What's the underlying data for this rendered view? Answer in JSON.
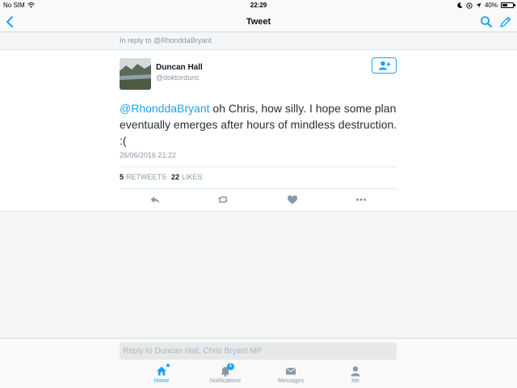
{
  "status_bar": {
    "carrier": "No SIM",
    "time": "22:29",
    "battery_percent": "40%",
    "battery_level": 0.4
  },
  "nav": {
    "title": "Tweet",
    "icons": [
      "chevron-left-icon",
      "search-icon",
      "compose-icon"
    ]
  },
  "reply_context": "In reply to @RhonddaBryant",
  "tweet": {
    "author_name": "Duncan Hall",
    "author_handle": "@doktordunc",
    "mention": "@RhonddaBryant",
    "text": " oh Chris, how silly. I hope some plan eventually emerges after hours of mindless destruction. :(",
    "timestamp": "26/06/2016 21:22",
    "retweets_count": "5",
    "retweets_label": "RETWEETS",
    "likes_count": "22",
    "likes_label": "LIKES"
  },
  "actions": [
    "reply-icon",
    "retweet-icon",
    "like-icon",
    "more-icon"
  ],
  "composer": {
    "placeholder": "Reply to Duncan Hall, Chris Bryant MP"
  },
  "tab_bar": {
    "tabs": [
      {
        "label": "Home",
        "icon": "home-icon",
        "active": true
      },
      {
        "label": "Notifications",
        "icon": "bell-icon",
        "badge": "1"
      },
      {
        "label": "Messages",
        "icon": "envelope-icon"
      },
      {
        "label": "Me",
        "icon": "person-icon"
      }
    ]
  },
  "colors": {
    "accent": "#1da1f2",
    "muted": "#8899a6",
    "text": "#292f33"
  }
}
